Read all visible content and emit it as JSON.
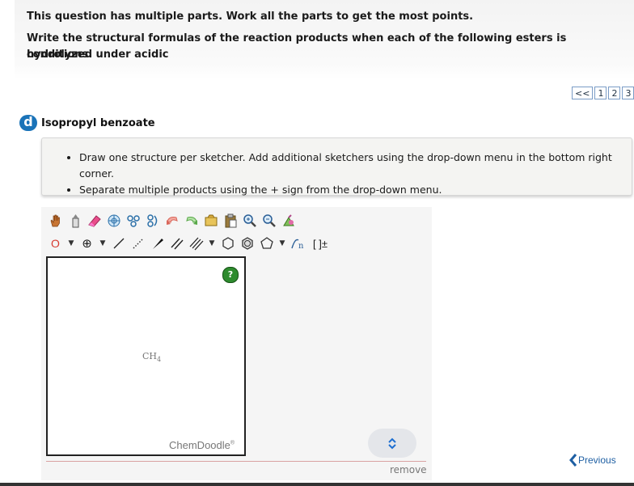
{
  "header": {
    "line1": "This question has multiple parts. Work all the parts to get the most points.",
    "line2a": "Write the structural formulas of the reaction products when each of the following esters is hydrolyzed under acidic",
    "line2b": "conditions."
  },
  "pager": {
    "back": "<<",
    "pages": [
      "1",
      "2",
      "3"
    ]
  },
  "part": {
    "letter": "d",
    "title": "Isopropyl benzoate"
  },
  "instructions": [
    "Draw one structure per sketcher. Add additional sketchers using the drop-down menu in the bottom right corner.",
    "Separate multiple products using the + sign from the drop-down menu."
  ],
  "toolbar": {
    "row1": [
      "hand-icon",
      "lasso-icon",
      "eraser-icon",
      "ring-icon",
      "chain-icon",
      "chain2-icon",
      "undo-icon",
      "redo-icon",
      "template-icon",
      "clipboard-icon",
      "zoom-in-icon",
      "zoom-out-icon",
      "clean-icon"
    ],
    "row2_atom": "O",
    "charge_glyph": "⊕",
    "bracket_glyph": "[ ]±"
  },
  "canvas": {
    "help": "?",
    "molecule": "CH",
    "molecule_sub": "4",
    "brand": "ChemDoodle",
    "brand_mark": "®"
  },
  "footer": {
    "remove": "remove",
    "previous": "Previous"
  }
}
